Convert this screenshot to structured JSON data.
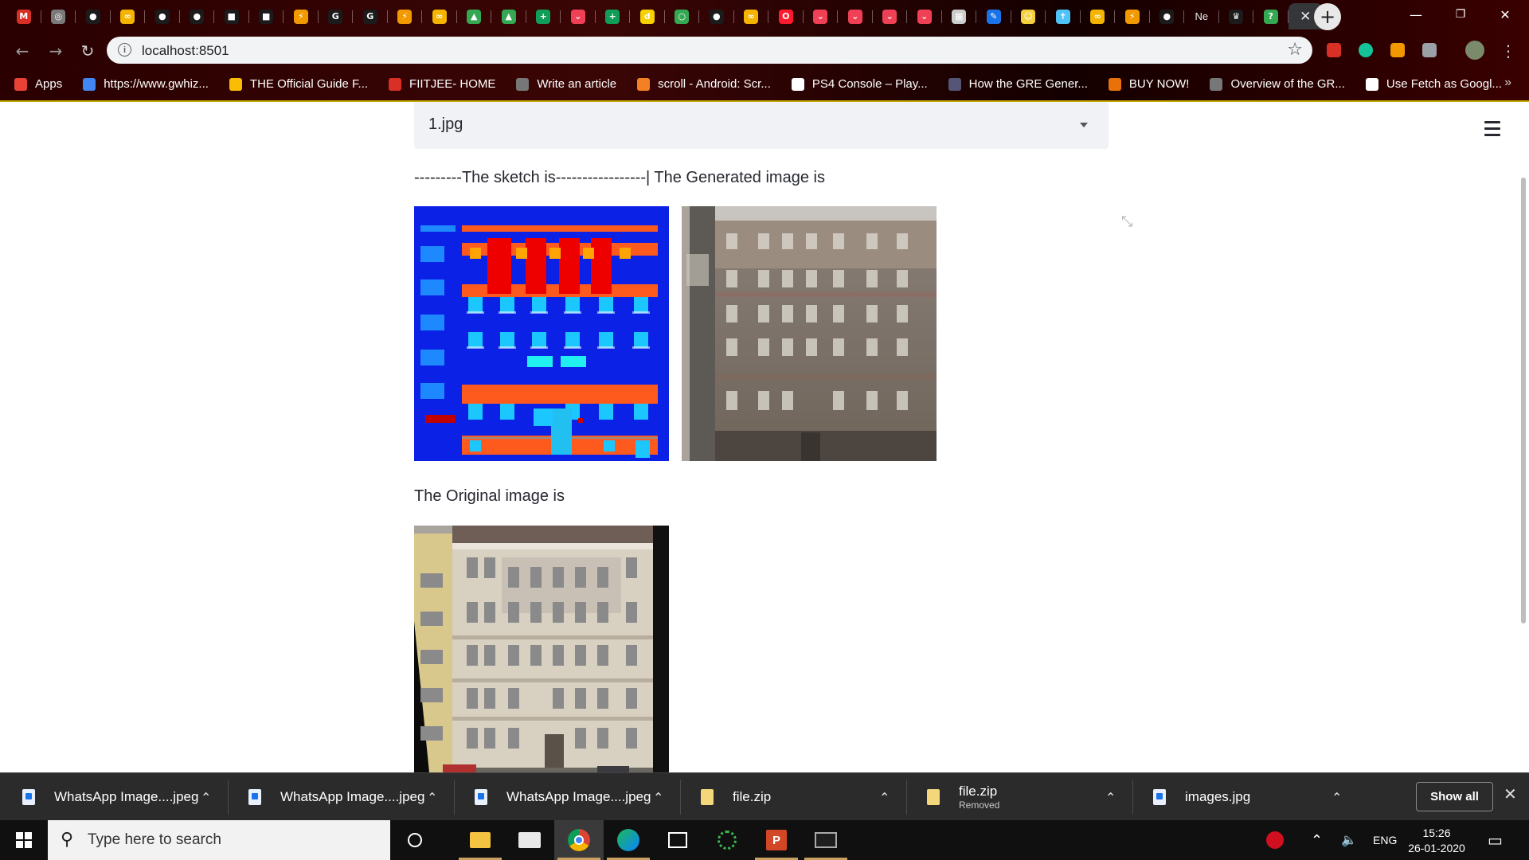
{
  "browser": {
    "url": "localhost:8501",
    "tabs": [
      {
        "icon": "gmail-icon",
        "color": "#d93025",
        "glyph": "M"
      },
      {
        "icon": "globe-icon",
        "color": "#7a7a7a",
        "glyph": "◎"
      },
      {
        "icon": "github-icon",
        "color": "#ffffff",
        "glyph": "●"
      },
      {
        "icon": "infinity-icon",
        "color": "#f4b400",
        "glyph": "∞"
      },
      {
        "icon": "github-icon",
        "color": "#ffffff",
        "glyph": "●"
      },
      {
        "icon": "github-icon",
        "color": "#ffffff",
        "glyph": "●"
      },
      {
        "icon": "cube-icon",
        "color": "#ffffff",
        "glyph": "■"
      },
      {
        "icon": "cube-icon",
        "color": "#ffffff",
        "glyph": "■"
      },
      {
        "icon": "bolt-icon",
        "color": "#f29900",
        "glyph": "⚡"
      },
      {
        "icon": "google-icon",
        "color": "#ffffff",
        "glyph": "G"
      },
      {
        "icon": "google-icon",
        "color": "#ffffff",
        "glyph": "G"
      },
      {
        "icon": "bolt-icon",
        "color": "#f29900",
        "glyph": "⚡"
      },
      {
        "icon": "infinity-icon",
        "color": "#f4b400",
        "glyph": "∞"
      },
      {
        "icon": "drive-icon",
        "color": "#34a853",
        "glyph": "▲"
      },
      {
        "icon": "drive-icon",
        "color": "#34a853",
        "glyph": "▲"
      },
      {
        "icon": "plus-sheet-icon",
        "color": "#0f9d58",
        "glyph": "+"
      },
      {
        "icon": "pocket-icon",
        "color": "#ef4056",
        "glyph": "⌄"
      },
      {
        "icon": "plus-sheet-icon",
        "color": "#0f9d58",
        "glyph": "+"
      },
      {
        "icon": "d-icon",
        "color": "#f7d000",
        "glyph": "d"
      },
      {
        "icon": "circle-icon",
        "color": "#34a853",
        "glyph": "○"
      },
      {
        "icon": "github-icon",
        "color": "#ffffff",
        "glyph": "●"
      },
      {
        "icon": "infinity-icon",
        "color": "#f4b400",
        "glyph": "∞"
      },
      {
        "icon": "opera-icon",
        "color": "#ff1b2d",
        "glyph": "O"
      },
      {
        "icon": "pocket-icon",
        "color": "#ef4056",
        "glyph": "⌄"
      },
      {
        "icon": "pocket-icon",
        "color": "#ef4056",
        "glyph": "⌄"
      },
      {
        "icon": "pocket-icon",
        "color": "#ef4056",
        "glyph": "⌄"
      },
      {
        "icon": "pocket-icon",
        "color": "#ef4056",
        "glyph": "⌄"
      },
      {
        "icon": "grid-icon",
        "color": "#cccccc",
        "glyph": "▦"
      },
      {
        "icon": "edit-icon",
        "color": "#1a73e8",
        "glyph": "✎"
      },
      {
        "icon": "smiley-icon",
        "color": "#f4d03f",
        "glyph": "☺"
      },
      {
        "icon": "pin-icon",
        "color": "#4fc3f7",
        "glyph": "✝"
      },
      {
        "icon": "infinity-icon",
        "color": "#f4b400",
        "glyph": "∞"
      },
      {
        "icon": "bolt-icon",
        "color": "#f29900",
        "glyph": "⚡"
      },
      {
        "icon": "github-icon",
        "color": "#ffffff",
        "glyph": "●"
      },
      {
        "icon": "text",
        "color": "#e8eaed",
        "glyph": "Ne"
      },
      {
        "icon": "crown-icon",
        "color": "#ffffff",
        "glyph": "♛"
      },
      {
        "icon": "question-icon",
        "color": "#34a853",
        "glyph": "?"
      }
    ],
    "active_tab_close": "✕",
    "new_tab": "+"
  },
  "bookmarks": [
    {
      "label": "Apps",
      "color": "#ea4335"
    },
    {
      "label": "https://www.gwhiz...",
      "color": "#4285f4"
    },
    {
      "label": "THE Official Guide F...",
      "color": "#fbbc05"
    },
    {
      "label": "FIITJEE- HOME",
      "color": "#d93025"
    },
    {
      "label": "Write an article",
      "color": "#777777"
    },
    {
      "label": "scroll - Android: Scr...",
      "color": "#f48024"
    },
    {
      "label": "PS4 Console – Play...",
      "color": "#ffffff"
    },
    {
      "label": "How the GRE Gener...",
      "color": "#555577"
    },
    {
      "label": "BUY NOW!",
      "color": "#e8710a"
    },
    {
      "label": "Overview of the GR...",
      "color": "#777777"
    },
    {
      "label": "Use Fetch as Googl...",
      "color": "#ffffff"
    }
  ],
  "app": {
    "select_value": "1.jpg",
    "caption_top": "---------The sketch is-----------------| The Generated image is",
    "caption_original": "The Original image is"
  },
  "downloads": [
    {
      "name": "WhatsApp Image....jpeg",
      "sub": "",
      "type": "image"
    },
    {
      "name": "WhatsApp Image....jpeg",
      "sub": "",
      "type": "image"
    },
    {
      "name": "WhatsApp Image....jpeg",
      "sub": "",
      "type": "image"
    },
    {
      "name": "file.zip",
      "sub": "",
      "type": "zip"
    },
    {
      "name": "file.zip",
      "sub": "Removed",
      "type": "zip"
    },
    {
      "name": "images.jpg",
      "sub": "",
      "type": "image"
    }
  ],
  "downloads_show_all": "Show all",
  "taskbar": {
    "search_placeholder": "Type here to search",
    "language": "ENG",
    "time": "15:26",
    "date": "26-01-2020"
  }
}
